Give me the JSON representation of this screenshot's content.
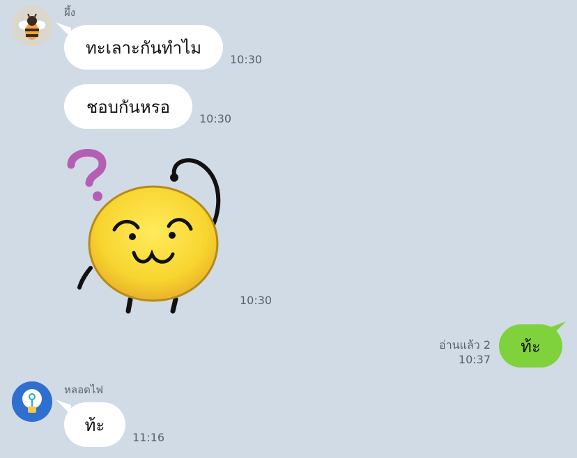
{
  "conversation": {
    "messages": [
      {
        "sender": "ผึ้ง",
        "text": "ทะเลาะกันทำไม",
        "time": "10:30"
      },
      {
        "sender": "ผึ้ง",
        "text": "ชอบกันหรอ",
        "time": "10:30"
      },
      {
        "sender": "ผึ้ง",
        "sticker": "confused-yellow-blob",
        "time": "10:30"
      },
      {
        "sender": "me",
        "text": "ท้ะ",
        "read": "อ่านแล้ว 2",
        "time": "10:37"
      },
      {
        "sender": "หลอดไฟ",
        "text": "ท้ะ",
        "time": "11:16"
      }
    ]
  },
  "avatars": {
    "bee": "bee-avatar-icon",
    "bulb": "lightbulb-avatar-icon"
  },
  "colors": {
    "background": "#d1dbe6",
    "incoming_bubble": "#ffffff",
    "outgoing_bubble": "#7fd23c",
    "meta_text": "#556070"
  }
}
